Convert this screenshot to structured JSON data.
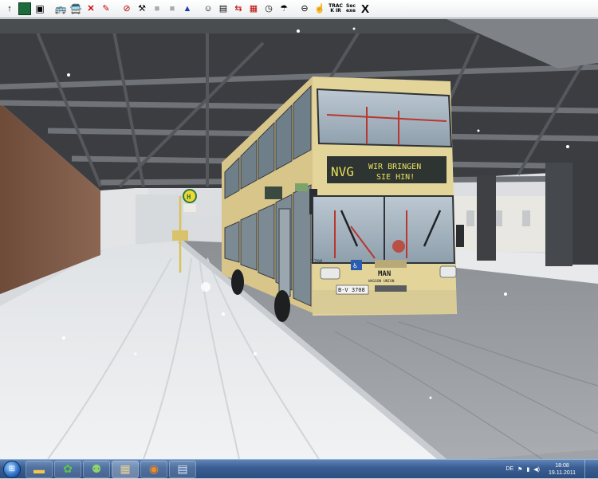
{
  "toolbar": {
    "track_ir": "TRACK IR",
    "sec_label": "Sec",
    "frac_label": "exe",
    "close_glyph": "X"
  },
  "bus": {
    "destination_route": "NVG",
    "destination_line1": "WIR BRINGEN",
    "destination_line2": "SIE HIN!",
    "fleet_number": "3708",
    "plate": "B-V 3708",
    "brand": "MAN",
    "bodywork": "WAGGON UNION"
  },
  "tray": {
    "language": "DE",
    "time": "18:08",
    "date": "19.11.2011"
  },
  "colors": {
    "bus_yellow": "#e3d49a",
    "taskbar_blue": "#3b5f93",
    "snow": "#eef0f2"
  }
}
